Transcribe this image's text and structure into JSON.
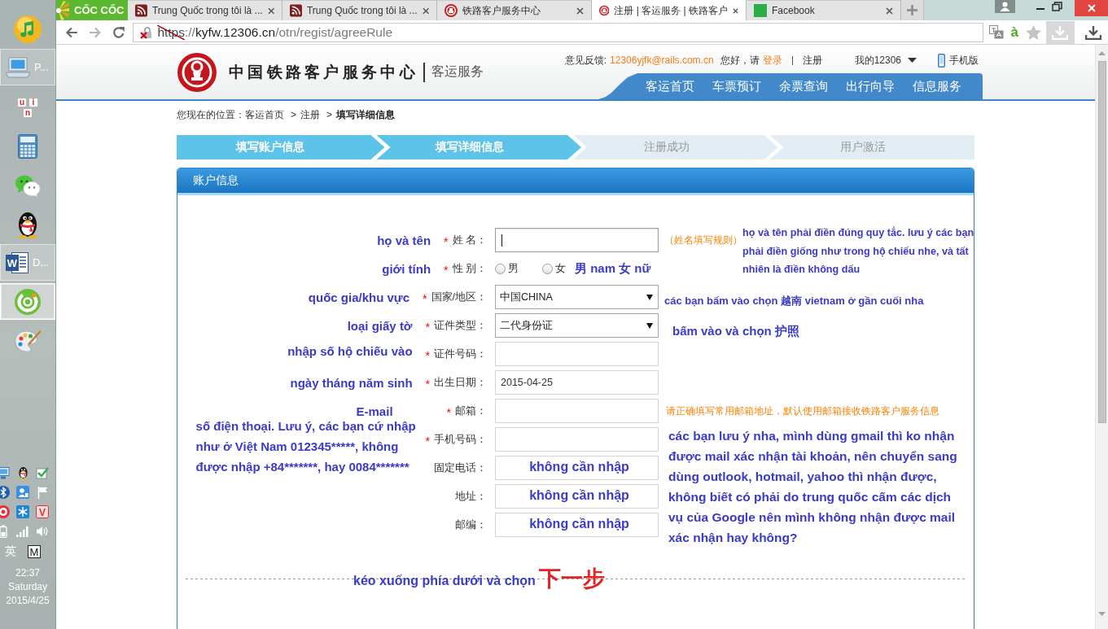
{
  "taskbar": {
    "apps": [
      {
        "kind": "music",
        "selected": false
      },
      {
        "kind": "laptop",
        "label": "P...",
        "selected": false
      },
      {
        "kind": "keys",
        "letters": [
          "u",
          "i",
          "n"
        ],
        "selected": false
      },
      {
        "kind": "calculator",
        "selected": false
      },
      {
        "kind": "chat",
        "selected": false
      },
      {
        "kind": "penguin",
        "selected": false
      },
      {
        "kind": "document",
        "glyph": "W",
        "label": "D...",
        "selected": false
      },
      {
        "kind": "spiral",
        "selected": true
      },
      {
        "kind": "palette",
        "selected": false
      }
    ],
    "tray": [
      {
        "kind": "monitor"
      },
      {
        "kind": "penguin"
      },
      {
        "kind": "tick"
      },
      {
        "kind": "bluetooth"
      },
      {
        "kind": "contact"
      },
      {
        "kind": "flag"
      },
      {
        "kind": "target"
      },
      {
        "kind": "snowflake"
      },
      {
        "kind": "letter",
        "glyph": "V"
      },
      {
        "kind": "battery"
      },
      {
        "kind": "signal"
      },
      {
        "kind": "speaker"
      }
    ],
    "input_language": "英",
    "ime_mode": "M",
    "time": "22:37",
    "day": "Saturday",
    "date": "2015/4/25"
  },
  "browser": {
    "brand": "CỐC CỐC",
    "tabs": [
      {
        "kind": "feed",
        "title": "Trung Quốc trong tôi là ...",
        "selected": false
      },
      {
        "kind": "feed",
        "title": "Trung Quốc trong tôi là ...",
        "selected": false
      },
      {
        "kind": "rail",
        "title": "铁路客户服务中心",
        "selected": false
      },
      {
        "kind": "rail",
        "title": "注册 | 客运服务 | 铁路客户",
        "selected": true
      },
      {
        "kind": "tile",
        "title": "Facebook",
        "selected": false
      }
    ],
    "url": {
      "secure": false,
      "scheme": "https",
      "separator": "://",
      "host": "kyfw.12306.cn",
      "path": "/otn/regist/agreeRule"
    },
    "tools": [
      {
        "kind": "translate"
      },
      {
        "kind": "dictionary",
        "glyph": "à"
      },
      {
        "kind": "star"
      },
      {
        "kind": "download",
        "disabled": true
      },
      {
        "kind": "download",
        "disabled": false
      }
    ]
  },
  "site": {
    "title": "中国铁路客户服务中心",
    "subtitle": "客运服务",
    "feedback_label": "意见反馈:",
    "feedback_email": "12306yjfk@rails.com.cn",
    "greeting": "您好，请",
    "login": "登录",
    "register": "注册",
    "account": "我的12306",
    "mobile": "手机版",
    "nav": [
      {
        "label": "客运首页"
      },
      {
        "label": "车票预订"
      },
      {
        "label": "余票查询"
      },
      {
        "label": "出行向导"
      },
      {
        "label": "信息服务"
      }
    ]
  },
  "breadcrumb": {
    "label": "您现在的位置：",
    "items": [
      {
        "label": "客运首页",
        "current": false
      },
      {
        "separator": ">",
        "label": "注册",
        "current": false
      },
      {
        "separator": ">",
        "label": "填写详细信息",
        "current": true
      }
    ]
  },
  "steps": [
    {
      "label": "填写账户信息",
      "done": true
    },
    {
      "label": "填写详细信息",
      "done": true
    },
    {
      "label": "注册成功",
      "done": false
    },
    {
      "label": "用户激活",
      "done": false
    }
  ],
  "panel": {
    "title": "账户信息",
    "fields": [
      {
        "kind": "text",
        "mark": "*",
        "label": "姓 名：",
        "focused": true,
        "note": "họ và tên",
        "hint": "（姓名填写规则）",
        "side_note": "họ và tên phải điền đúng quy tắc. lưu ý các bạn phải điền giống như trong hộ chiếu nhe, và tất nhiên là điền không dấu"
      },
      {
        "kind": "radio",
        "mark": "*",
        "label": "性 别：",
        "note": "giới tính",
        "options": [
          {
            "label": "男",
            "selected": false
          },
          {
            "label": "女",
            "selected": false
          }
        ],
        "inline_note": "男 nam 女 nữ"
      },
      {
        "kind": "select",
        "mark": "*",
        "label": "国家/地区：",
        "note": "quốc gia/khu vực",
        "value": "中国CHINA",
        "side_note": "các bạn bấm vào chọn 越南 vietnam ở gần cuối nha"
      },
      {
        "kind": "select",
        "mark": "*",
        "label": "证件类型：",
        "note": "loại giấy tờ",
        "value": "二代身份证",
        "side_note": "bấm vào và chọn 护照"
      },
      {
        "kind": "text",
        "mark": "*",
        "label": "证件号码：",
        "focused": false,
        "note": "nhập số hộ chiếu vào"
      },
      {
        "kind": "text",
        "mark": "*",
        "label": "出生日期：",
        "focused": false,
        "note": "ngày tháng năm sinh",
        "value": "2015-04-25"
      },
      {
        "kind": "text",
        "mark": "*",
        "label": "邮箱：",
        "focused": false,
        "note": "E-mail",
        "hint": "请正确填写常用邮箱地址，默认使用邮箱接收铁路客户服务信息"
      },
      {
        "kind": "text",
        "mark": "*",
        "label": "手机号码：",
        "focused": false,
        "note": "số điện thoại. Lưu ý, các bạn cứ nhập như ở Việt Nam 012345*****, không được nhập +84*******, hay 0084*******",
        "side_note": "các bạn lưu ý nha, mình dùng gmail thì ko nhận được mail xác nhận tài khoản, nên chuyển sang dùng outlook, hotmail, yahoo thì nhận được, không biết có phải do trung quốc cấm các dịch vụ của Google nên mình không nhận được mail xác nhận hay không?"
      },
      {
        "kind": "text",
        "label": "固定电话：",
        "focused": false,
        "inner_note": "không cần nhập"
      },
      {
        "kind": "text",
        "label": "地址：",
        "focused": false,
        "inner_note": "không cần nhập"
      },
      {
        "kind": "text",
        "label": "邮编：",
        "focused": false,
        "inner_note": "không cần nhập"
      }
    ],
    "footer_note": "kéo xuống phía dưới và chọn",
    "next_step": "下一步"
  }
}
